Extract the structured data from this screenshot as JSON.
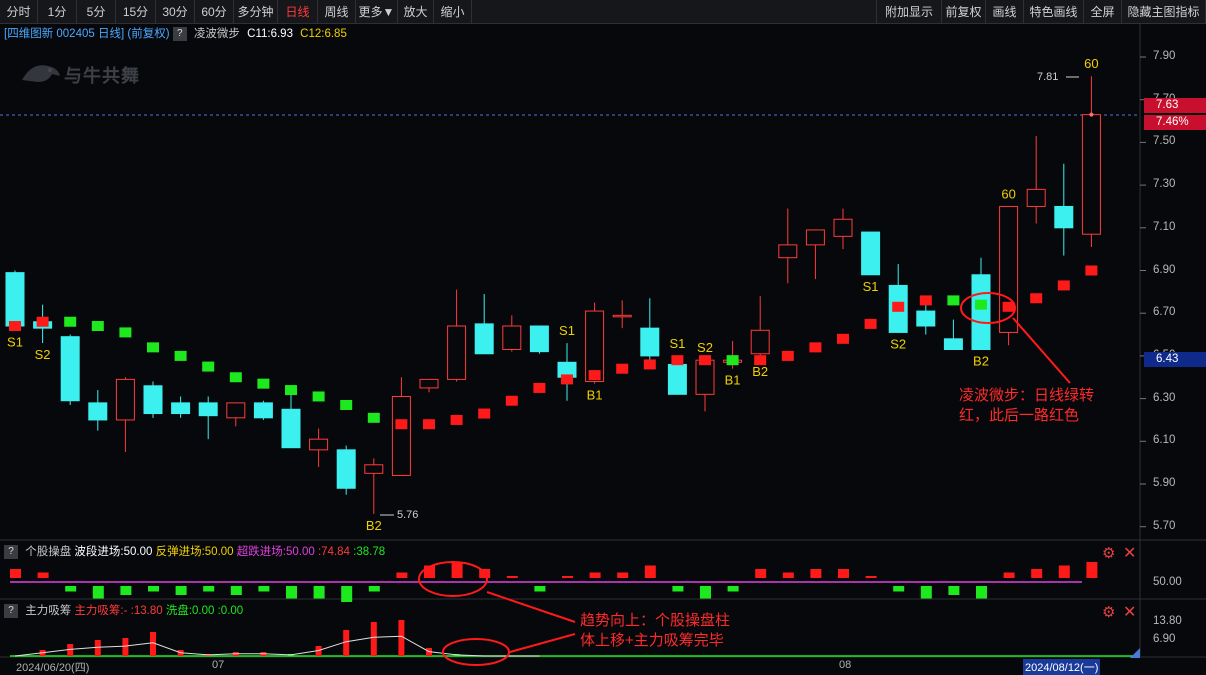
{
  "toolbar": {
    "left": [
      "分时",
      "1分",
      "5分",
      "15分",
      "30分",
      "60分",
      "多分钟",
      "日线",
      "周线",
      "更多▼",
      "放大",
      "缩小"
    ],
    "active": "日线",
    "right": [
      "附加显示",
      "前复权",
      "画线",
      "特色画线",
      "全屏",
      "隐藏主图指标"
    ]
  },
  "header": {
    "tag": "[四维图新 002405 日线]",
    "adj": "(前复权)",
    "q": "?",
    "indicator": "凌波微步",
    "c11": "C11:6.93",
    "c12": "C12:6.85"
  },
  "watermark": "与牛共舞",
  "price_axis": [
    "7.90",
    "7.70",
    "7.50",
    "7.30",
    "7.10",
    "6.90",
    "6.70",
    "6.50",
    "6.30",
    "6.10",
    "5.90",
    "5.70"
  ],
  "price_tags": {
    "last_price": "7.63",
    "last_pct": "7.46%",
    "marker": "6.43"
  },
  "annotations": {
    "high": "7.81",
    "low": "5.76",
    "note_main_1": "凌波微步：日线绿转",
    "note_main_2": "红，此后一路红色",
    "note_sub_1": "趋势向上：个股操盘柱",
    "note_sub_2": "体上移+主力吸筹完毕"
  },
  "panel1": {
    "q": "?",
    "name": "个股操盘",
    "a": "波段进场:50.00",
    "b": "反弹进场:50.00",
    "c": "超跌进场:50.00",
    "d": ":74.84",
    "e": ":38.78",
    "axis": "50.00"
  },
  "panel2": {
    "q": "?",
    "name": "主力吸筹",
    "a": "主力吸筹:-",
    "b": ":13.80",
    "c": "洗盘:0.00",
    "d": ":0.00",
    "axis_top": "13.80",
    "axis_mid": "6.90"
  },
  "dates": {
    "start": "2024/06/20(四)",
    "m07": "07",
    "m08": "08",
    "end": "2024/08/12(一)"
  },
  "colors": {
    "up": "#ff3b3b",
    "down": "#3cf0f0",
    "green": "#1ee81e",
    "red": "#ff1a1a",
    "yellow": "#f0d000",
    "magenta": "#e040e0"
  },
  "chart_data": {
    "type": "candlestick",
    "title": "四维图新 002405 日线",
    "ylim": [
      5.66,
      8.0
    ],
    "candles": [
      {
        "o": 6.89,
        "h": 6.9,
        "l": 6.62,
        "c": 6.64
      },
      {
        "o": 6.66,
        "h": 6.74,
        "l": 6.56,
        "c": 6.63
      },
      {
        "o": 6.59,
        "h": 6.6,
        "l": 6.27,
        "c": 6.29
      },
      {
        "o": 6.28,
        "h": 6.34,
        "l": 6.15,
        "c": 6.2
      },
      {
        "o": 6.2,
        "h": 6.4,
        "l": 6.05,
        "c": 6.39
      },
      {
        "o": 6.36,
        "h": 6.38,
        "l": 6.21,
        "c": 6.23
      },
      {
        "o": 6.28,
        "h": 6.31,
        "l": 6.21,
        "c": 6.23
      },
      {
        "o": 6.28,
        "h": 6.31,
        "l": 6.11,
        "c": 6.22
      },
      {
        "o": 6.21,
        "h": 6.28,
        "l": 6.17,
        "c": 6.28
      },
      {
        "o": 6.28,
        "h": 6.29,
        "l": 6.2,
        "c": 6.21
      },
      {
        "o": 6.25,
        "h": 6.32,
        "l": 6.07,
        "c": 6.07
      },
      {
        "o": 6.06,
        "h": 6.16,
        "l": 5.98,
        "c": 6.11
      },
      {
        "o": 6.06,
        "h": 6.08,
        "l": 5.85,
        "c": 5.88
      },
      {
        "o": 5.95,
        "h": 6.02,
        "l": 5.76,
        "c": 5.99
      },
      {
        "o": 5.94,
        "h": 6.4,
        "l": 5.94,
        "c": 6.31
      },
      {
        "o": 6.35,
        "h": 6.39,
        "l": 6.33,
        "c": 6.39
      },
      {
        "o": 6.39,
        "h": 6.81,
        "l": 6.38,
        "c": 6.64
      },
      {
        "o": 6.65,
        "h": 6.79,
        "l": 6.51,
        "c": 6.51
      },
      {
        "o": 6.53,
        "h": 6.69,
        "l": 6.52,
        "c": 6.64
      },
      {
        "o": 6.64,
        "h": 6.64,
        "l": 6.51,
        "c": 6.52
      },
      {
        "o": 6.47,
        "h": 6.56,
        "l": 6.29,
        "c": 6.4
      },
      {
        "o": 6.38,
        "h": 6.75,
        "l": 6.37,
        "c": 6.71
      },
      {
        "o": 6.69,
        "h": 6.76,
        "l": 6.63,
        "c": 6.69
      },
      {
        "o": 6.63,
        "h": 6.77,
        "l": 6.47,
        "c": 6.5
      },
      {
        "o": 6.46,
        "h": 6.5,
        "l": 6.32,
        "c": 6.32
      },
      {
        "o": 6.32,
        "h": 6.48,
        "l": 6.24,
        "c": 6.48
      },
      {
        "o": 6.47,
        "h": 6.57,
        "l": 6.44,
        "c": 6.48
      },
      {
        "o": 6.51,
        "h": 6.78,
        "l": 6.48,
        "c": 6.62
      },
      {
        "o": 6.96,
        "h": 7.19,
        "l": 6.84,
        "c": 7.02
      },
      {
        "o": 7.02,
        "h": 7.08,
        "l": 6.86,
        "c": 7.09
      },
      {
        "o": 7.06,
        "h": 7.19,
        "l": 7.0,
        "c": 7.14
      },
      {
        "o": 7.08,
        "h": 7.08,
        "l": 6.88,
        "c": 6.88
      },
      {
        "o": 6.83,
        "h": 6.93,
        "l": 6.61,
        "c": 6.61
      },
      {
        "o": 6.71,
        "h": 6.75,
        "l": 6.6,
        "c": 6.64
      },
      {
        "o": 6.58,
        "h": 6.67,
        "l": 6.53,
        "c": 6.53
      },
      {
        "o": 6.88,
        "h": 6.96,
        "l": 6.53,
        "c": 6.53
      },
      {
        "o": 6.61,
        "h": 7.2,
        "l": 6.55,
        "c": 7.2
      },
      {
        "o": 7.2,
        "h": 7.53,
        "l": 7.12,
        "c": 7.28
      },
      {
        "o": 7.2,
        "h": 7.4,
        "l": 6.97,
        "c": 7.1
      },
      {
        "o": 7.07,
        "h": 7.81,
        "l": 7.01,
        "c": 7.63
      }
    ],
    "signal": [
      {
        "v": 6.64,
        "t": "red"
      },
      {
        "v": 6.66,
        "t": "red"
      },
      {
        "v": 6.66,
        "t": "green"
      },
      {
        "v": 6.64,
        "t": "green"
      },
      {
        "v": 6.61,
        "t": "green"
      },
      {
        "v": 6.54,
        "t": "green"
      },
      {
        "v": 6.5,
        "t": "green"
      },
      {
        "v": 6.45,
        "t": "green"
      },
      {
        "v": 6.4,
        "t": "green"
      },
      {
        "v": 6.37,
        "t": "green"
      },
      {
        "v": 6.34,
        "t": "green"
      },
      {
        "v": 6.31,
        "t": "green"
      },
      {
        "v": 6.27,
        "t": "green"
      },
      {
        "v": 6.21,
        "t": "green"
      },
      {
        "v": 6.18,
        "t": "red"
      },
      {
        "v": 6.18,
        "t": "red"
      },
      {
        "v": 6.2,
        "t": "red"
      },
      {
        "v": 6.23,
        "t": "red"
      },
      {
        "v": 6.29,
        "t": "red"
      },
      {
        "v": 6.35,
        "t": "red"
      },
      {
        "v": 6.39,
        "t": "red"
      },
      {
        "v": 6.41,
        "t": "red"
      },
      {
        "v": 6.44,
        "t": "red"
      },
      {
        "v": 6.46,
        "t": "red"
      },
      {
        "v": 6.48,
        "t": "red"
      },
      {
        "v": 6.48,
        "t": "red"
      },
      {
        "v": 6.48,
        "t": "green"
      },
      {
        "v": 6.48,
        "t": "red"
      },
      {
        "v": 6.5,
        "t": "red"
      },
      {
        "v": 6.54,
        "t": "red"
      },
      {
        "v": 6.58,
        "t": "red"
      },
      {
        "v": 6.65,
        "t": "red"
      },
      {
        "v": 6.73,
        "t": "red"
      },
      {
        "v": 6.76,
        "t": "red"
      },
      {
        "v": 6.76,
        "t": "green"
      },
      {
        "v": 6.74,
        "t": "green"
      },
      {
        "v": 6.73,
        "t": "red"
      },
      {
        "v": 6.77,
        "t": "red"
      },
      {
        "v": 6.83,
        "t": "red"
      },
      {
        "v": 6.9,
        "t": "red"
      }
    ],
    "labels": [
      {
        "i": 0,
        "t": "S1",
        "pos": "below"
      },
      {
        "i": 1,
        "t": "S2",
        "pos": "below"
      },
      {
        "i": 13,
        "t": "B2",
        "pos": "below"
      },
      {
        "i": 20,
        "t": "S1",
        "pos": "above"
      },
      {
        "i": 21,
        "t": "B1",
        "pos": "below"
      },
      {
        "i": 24,
        "t": "S1",
        "pos": "above"
      },
      {
        "i": 25,
        "t": "S2",
        "pos": "above"
      },
      {
        "i": 26,
        "t": "B1",
        "pos": "below"
      },
      {
        "i": 27,
        "t": "B2",
        "pos": "below"
      },
      {
        "i": 31,
        "t": "S1",
        "pos": "below"
      },
      {
        "i": 32,
        "t": "S2",
        "pos": "below"
      },
      {
        "i": 35,
        "t": "B2",
        "pos": "below"
      },
      {
        "i": 36,
        "t": "60",
        "pos": "above"
      },
      {
        "i": 39,
        "t": "60",
        "pos": "above"
      }
    ],
    "panel1_values": [
      2,
      1,
      -1,
      -3,
      -2,
      -1,
      -2,
      -1,
      -2,
      -1,
      -3,
      -3,
      -4,
      -1,
      1,
      3,
      4,
      2,
      0,
      -1,
      0,
      1,
      1,
      3,
      -1,
      -3,
      -1,
      2,
      1,
      2,
      2,
      0,
      -1,
      -3,
      -2,
      -3,
      1,
      2,
      3,
      4
    ],
    "panel2_values": [
      0,
      3,
      6,
      8,
      9,
      12,
      3,
      1,
      2,
      2,
      1,
      5,
      13,
      17,
      18,
      4,
      1,
      0,
      0,
      0
    ]
  }
}
